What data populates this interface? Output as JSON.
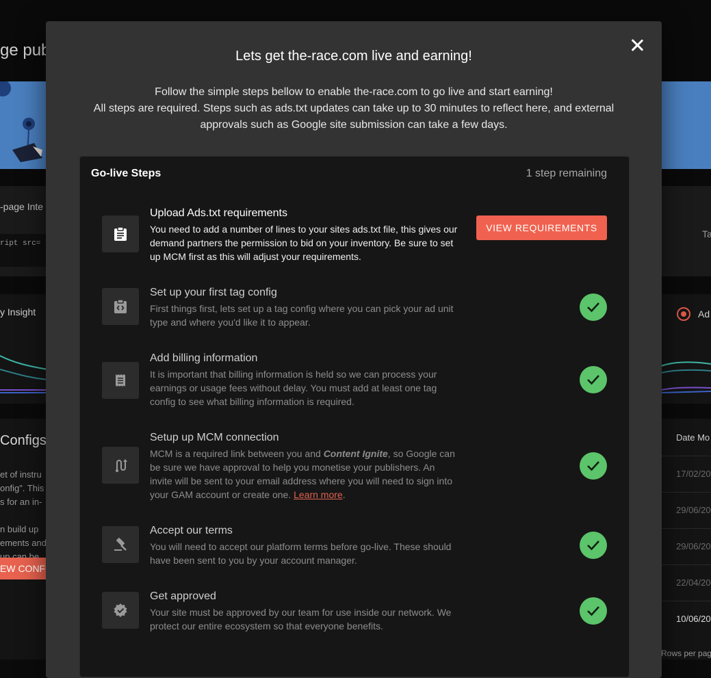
{
  "background": {
    "heading": "ge pub",
    "integration_label": "-page Inte",
    "code_snippet": "ript src=",
    "right_label": "Ta",
    "insight_label": "y Insight",
    "radio_label": "Ad",
    "configs_title": "Configs",
    "configs_lines": [
      "et of instru",
      "onfig\". This",
      "s for an in-",
      "",
      "n build up",
      "ements and",
      " up can be"
    ],
    "view_button": "EW CONFI",
    "table_header": "Date Mo",
    "table_dates": [
      "17/02/20",
      "29/06/20",
      "29/06/20",
      "22/04/20",
      "10/06/20"
    ],
    "rows_per_page": "Rows per pag"
  },
  "modal": {
    "title": "Lets get the-race.com live and earning!",
    "subtitle_line1": "Follow the simple steps bellow to enable the-race.com to go live and start earning!",
    "subtitle_line2": "All steps are required. Steps such as ads.txt updates can take up to 30 minutes to reflect here, and external approvals such as Google site submission can take a few days.",
    "card_title": "Go-live Steps",
    "remaining": "1 step remaining",
    "steps": [
      {
        "title": "Upload Ads.txt requirements",
        "desc": "You need to add a number of lines to your sites ads.txt file, this gives our demand partners the permission to bid on your inventory. Be sure to set up MCM first as this will adjust your requirements.",
        "action": "VIEW REQUIREMENTS",
        "icon": "clipboard-icon"
      },
      {
        "title": "Set up your first tag config",
        "desc": "First things first, lets set up a tag config where you can pick your ad unit type and where you'd like it to appear.",
        "icon": "code-clipboard-icon"
      },
      {
        "title": "Add billing information",
        "desc": "It is important that billing information is held so we can process your earnings or usage fees without delay. You must add at least one tag config to see what billing information is required.",
        "icon": "receipt-icon"
      },
      {
        "title": "Setup up MCM connection",
        "desc_before": "MCM is a required link between you and ",
        "desc_brand": "Content Ignite",
        "desc_middle": ", so Google can be sure we have approval to help you monetise your publishers. An invite will be sent to your email address where you will need to sign into your GAM account or create one. ",
        "desc_link": "Learn more",
        "desc_after": ".",
        "icon": "route-icon"
      },
      {
        "title": "Accept our terms",
        "desc": "You will need to accept our platform terms before go-live. These should have been sent to you by your account manager.",
        "icon": "gavel-icon"
      },
      {
        "title": "Get approved",
        "desc": "Your site must be approved by our team for use inside our network. We protect our entire ecosystem so that everyone benefits.",
        "icon": "verified-badge-icon"
      }
    ],
    "colors": {
      "accent": "#f0624f",
      "success": "#5cc46a",
      "modal_bg": "#333333",
      "card_bg": "#161616"
    }
  }
}
